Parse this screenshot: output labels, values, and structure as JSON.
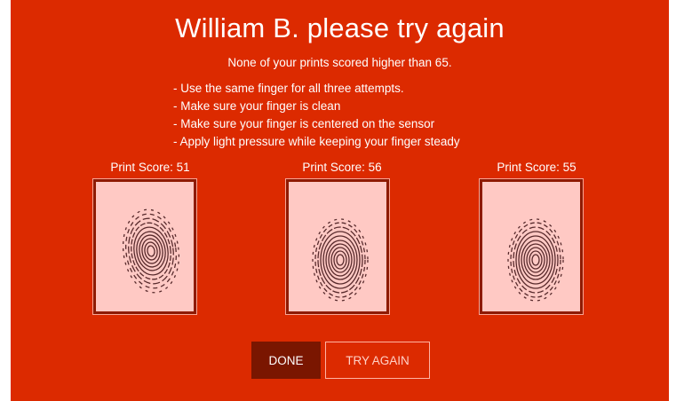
{
  "header": {
    "title": "William B. please try again",
    "subtitle": "None of your prints scored higher than 65."
  },
  "instructions": [
    "- Use the same finger for all three attempts.",
    "- Make sure your finger is clean",
    "- Make sure your finger is centered on the sensor",
    "- Apply light pressure while keeping your finger steady"
  ],
  "prints": [
    {
      "label": "Print Score: 51",
      "score": 51
    },
    {
      "label": "Print Score: 56",
      "score": 56
    },
    {
      "label": "Print Score: 55",
      "score": 55
    }
  ],
  "buttons": {
    "done": "DONE",
    "try_again": "TRY AGAIN"
  },
  "colors": {
    "background": "#dc2a00",
    "print_bg": "#ffc9c4",
    "frame": "#8e1a00",
    "done_button": "#7a1600"
  }
}
